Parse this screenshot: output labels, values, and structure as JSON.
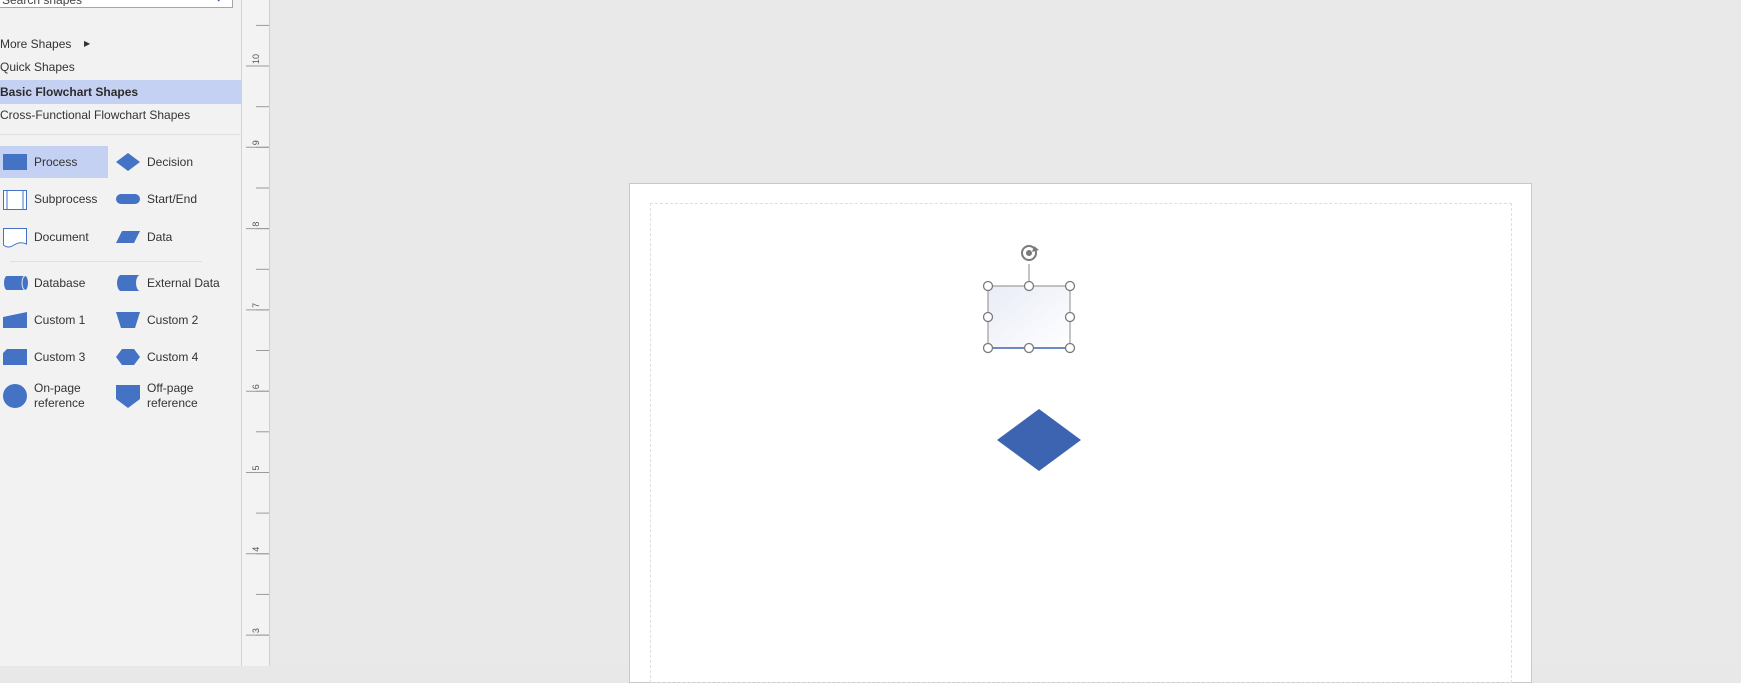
{
  "search": {
    "value": "Search shapes"
  },
  "nav": {
    "more_shapes": "More Shapes",
    "quick_shapes": "Quick Shapes",
    "basic_flowchart": "Basic Flowchart Shapes",
    "cross_functional": "Cross-Functional Flowchart Shapes"
  },
  "shapes": [
    {
      "label": "Process",
      "icon": "process-icon"
    },
    {
      "label": "Decision",
      "icon": "decision-icon"
    },
    {
      "label": "Subprocess",
      "icon": "subprocess-icon"
    },
    {
      "label": "Start/End",
      "icon": "start-end-icon"
    },
    {
      "label": "Document",
      "icon": "document-icon"
    },
    {
      "label": "Data",
      "icon": "data-icon"
    },
    {
      "label": "Database",
      "icon": "database-icon"
    },
    {
      "label": "External Data",
      "icon": "external-data-icon"
    },
    {
      "label": "Custom 1",
      "icon": "custom-1-icon"
    },
    {
      "label": "Custom 2",
      "icon": "custom-2-icon"
    },
    {
      "label": "Custom 3",
      "icon": "custom-3-icon"
    },
    {
      "label": "Custom 4",
      "icon": "custom-4-icon"
    },
    {
      "label": "On-page reference",
      "icon": "on-page-reference-icon"
    },
    {
      "label": "Off-page reference",
      "icon": "off-page-reference-icon"
    }
  ],
  "ruler": {
    "labels": [
      "10",
      "9",
      "8",
      "7",
      "6",
      "5",
      "4",
      "3"
    ]
  },
  "colors": {
    "shape_blue": "#3d64b0",
    "selected_bg": "#c5d1f3",
    "icon_blue": "#4472c4"
  }
}
